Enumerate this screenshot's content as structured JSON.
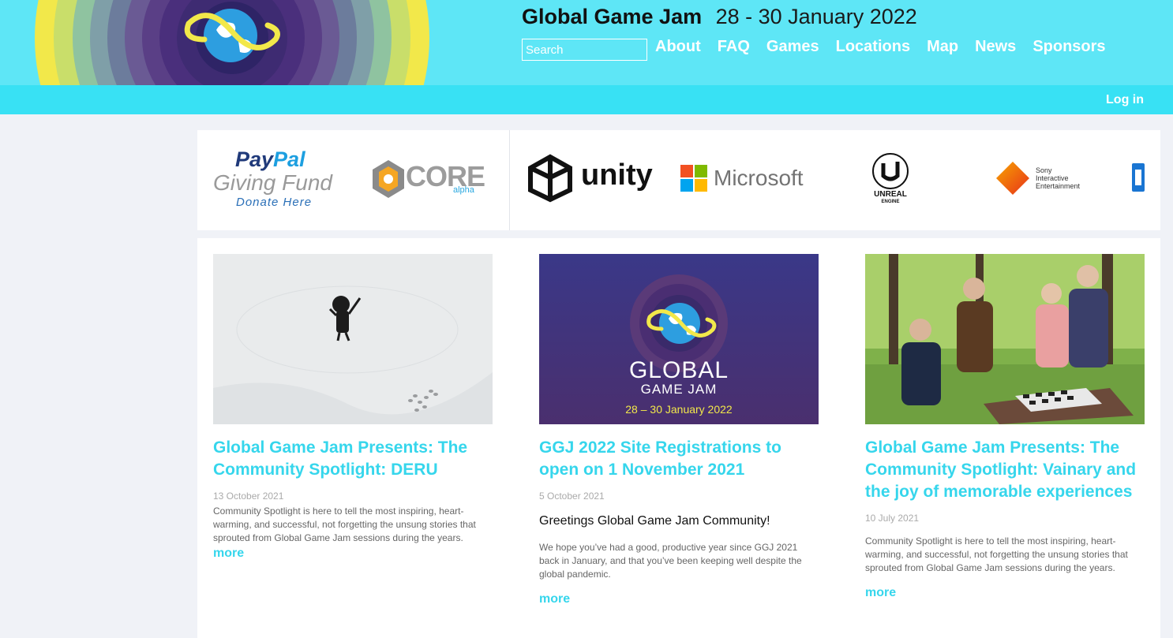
{
  "header": {
    "title": "Global Game Jam",
    "dates": "28 - 30 January 2022",
    "search_placeholder": "Search",
    "nav": [
      "About",
      "FAQ",
      "Games",
      "Locations",
      "Map",
      "News",
      "Sponsors"
    ],
    "login": "Log in"
  },
  "sponsors": {
    "paypal": {
      "line1a": "Pay",
      "line1b": "Pal",
      "line2": "Giving Fund",
      "line3": "Donate Here"
    },
    "core": {
      "text": "CORE",
      "sub": "alpha"
    },
    "unity": "unity",
    "microsoft": "Microsoft",
    "unreal": {
      "line1": "UNREAL",
      "line2": "ENGINE"
    },
    "sony": [
      "Sony",
      "Interactive",
      "Entertainment"
    ]
  },
  "news": [
    {
      "title": "Global Game Jam Presents: The Community Spotlight: DERU",
      "date": "13 October 2021",
      "greeting": "",
      "excerpt": "Community Spotlight is here to tell the most inspiring, heart-warming, and successful, not forgetting the unsung stories that sprouted from Global Game Jam sessions during the years.",
      "more": "more"
    },
    {
      "title": "GGJ 2022 Site Registrations to open on 1 November 2021",
      "date": "5 October 2021",
      "greeting": "Greetings Global Game Jam Community!",
      "excerpt": "We hope you’ve had a good, productive year since GGJ 2021 back in January, and that you’ve been keeping well despite the global pandemic.",
      "more": "more",
      "image": {
        "line1": "GLOBAL",
        "line2": "GAME JAM",
        "line3": "28 – 30 January 2022"
      }
    },
    {
      "title": "Global Game Jam Presents: The Community Spotlight: Vainary and the joy of memorable experiences",
      "date": "10 July 2021",
      "greeting": "",
      "excerpt": "Community Spotlight is here to tell the most inspiring, heart-warming, and successful, not forgetting the unsung stories that sprouted from Global Game Jam sessions during the years.",
      "more": "more"
    }
  ],
  "colors": {
    "header_bg": "#5ee6f6",
    "subbar_bg": "#38e1f4",
    "link": "#36d6ec",
    "page_bg": "#f0f2f7"
  }
}
